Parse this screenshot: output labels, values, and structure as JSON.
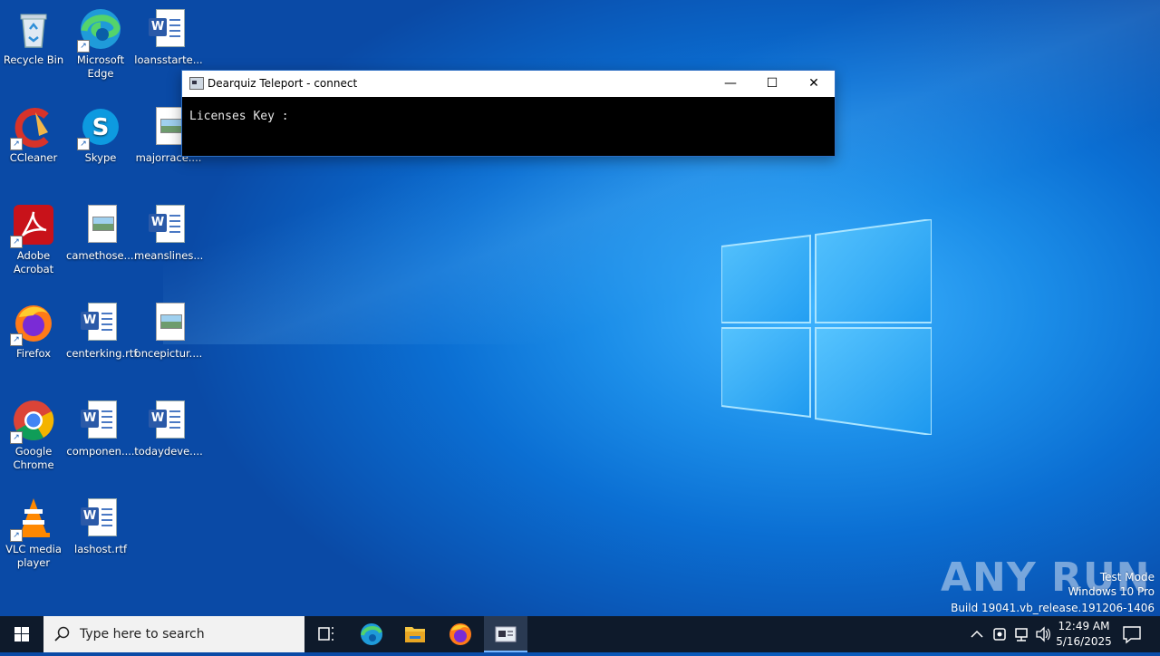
{
  "desktop": {
    "icons": [
      {
        "label": "Recycle Bin",
        "icon": "recycle-bin-icon"
      },
      {
        "label": "Microsoft Edge",
        "icon": "edge-icon"
      },
      {
        "label": "loansstarte...",
        "icon": "word-document-icon"
      },
      {
        "label": "CCleaner",
        "icon": "ccleaner-icon"
      },
      {
        "label": "Skype",
        "icon": "skype-icon"
      },
      {
        "label": "majorrace....",
        "icon": "image-file-icon"
      },
      {
        "label": "Adobe Acrobat",
        "icon": "acrobat-icon"
      },
      {
        "label": "camethose....",
        "icon": "image-file-icon"
      },
      {
        "label": "meanslines...",
        "icon": "word-document-icon"
      },
      {
        "label": "Firefox",
        "icon": "firefox-icon"
      },
      {
        "label": "centerking.rtf",
        "icon": "word-document-icon"
      },
      {
        "label": "oncepictur....",
        "icon": "image-file-icon"
      },
      {
        "label": "Google Chrome",
        "icon": "chrome-icon"
      },
      {
        "label": "componen....",
        "icon": "word-document-icon"
      },
      {
        "label": "todaydeve....",
        "icon": "word-document-icon"
      },
      {
        "label": "VLC media player",
        "icon": "vlc-icon"
      },
      {
        "label": "lashost.rtf",
        "icon": "word-document-icon"
      }
    ]
  },
  "console": {
    "title": "Dearquiz Teleport - connect",
    "body_text": "Licenses Key :",
    "minimize": "—",
    "maximize": "☐",
    "close": "✕"
  },
  "watermark": {
    "brand": "ANY RUN",
    "line1": "Test Mode",
    "line2": "Windows 10 Pro",
    "line3": "Build 19041.vb_release.191206-1406"
  },
  "taskbar": {
    "search_placeholder": "Type here to search",
    "clock_time": "12:49 AM",
    "clock_date": "5/16/2025",
    "pinned": [
      "task-view-icon",
      "edge-icon",
      "file-explorer-icon",
      "firefox-icon",
      "console-app-icon"
    ]
  },
  "colors": {
    "desktop_bg": "#0b6fd3",
    "taskbar_bg": "#0e1a2b",
    "console_bg": "#000000",
    "accent": "#77b6ff"
  }
}
